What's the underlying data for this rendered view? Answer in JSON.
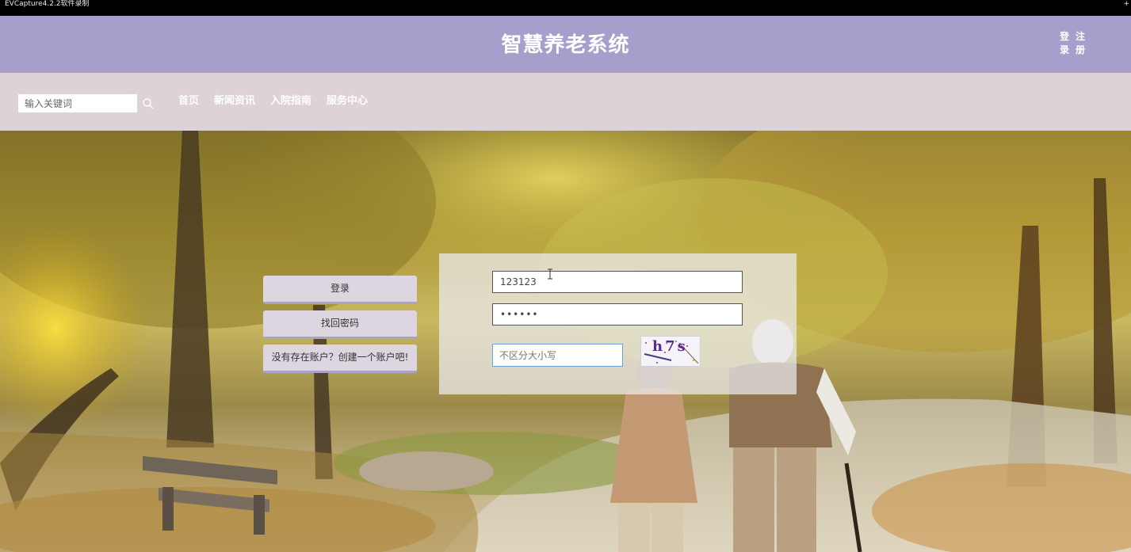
{
  "recorder": {
    "title": "EVCapture4.2.2软件录制",
    "mark": "+"
  },
  "header": {
    "site_title": "智慧养老系统",
    "login_link": "登录",
    "register_link": "注册"
  },
  "navbar": {
    "search_placeholder": "输入关键词",
    "links": [
      "首页",
      "新闻资讯",
      "入院指南",
      "服务中心"
    ]
  },
  "side_buttons": {
    "login": "登录",
    "recover": "找回密码",
    "register": "没有存在账户？创建一个账户吧!"
  },
  "login_form": {
    "username_value": "123123",
    "password_value": "••••••",
    "captcha_placeholder": "不区分大小写",
    "captcha_text": "h7s"
  },
  "colors": {
    "header_bg": "#a79fcb",
    "navbar_bg": "#dcd2d7",
    "button_bg": "#ddd6e0"
  }
}
